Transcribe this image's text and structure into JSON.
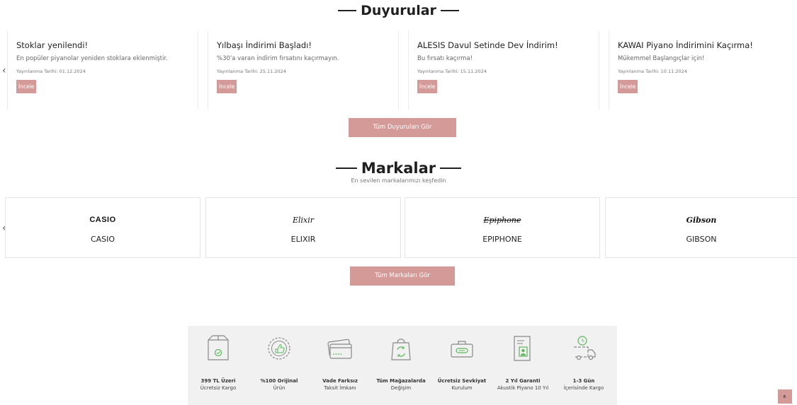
{
  "announcements": {
    "title": "Duyurular",
    "prev_arrow": "‹",
    "items": [
      {
        "title": "Stoklar yenilendi!",
        "desc": "En popüler piyanolar yeniden stoklara eklenmiştir.",
        "date": "Yayınlanma Tarihi: 01.12.2024",
        "button": "İncele"
      },
      {
        "title": "Yılbaşı İndirimi Başladı!",
        "desc": "%30'a varan indirim fırsatını kaçırmayın.",
        "date": "Yayınlanma Tarihi: 25.11.2024",
        "button": "İncele"
      },
      {
        "title": "ALESIS Davul Setinde Dev İndirim!",
        "desc": "Bu fırsatı kaçırma!",
        "date": "Yayınlanma Tarihi: 15.11.2024",
        "button": "İncele"
      },
      {
        "title": "KAWAI Piyano İndirimini Kaçırma!",
        "desc": "Mükemmel Başlangıçlar için!",
        "date": "Yayınlanma Tarihi: 10.11.2024",
        "button": "İncele"
      }
    ],
    "view_all": "Tüm Duyuruları Gör"
  },
  "brands": {
    "title": "Markalar",
    "subtitle": "En sevilen markalarımızı keşfedin",
    "prev_arrow": "‹",
    "items": [
      {
        "logo_text": "CASIO",
        "name": "CASIO"
      },
      {
        "logo_text": "Elixir",
        "name": "ELIXIR"
      },
      {
        "logo_text": "Epiphone",
        "name": "EPIPHONE"
      },
      {
        "logo_text": "Gibson",
        "name": "GIBSON"
      }
    ],
    "view_all": "Tüm Markaları Gör"
  },
  "features": [
    {
      "icon": "box-icon",
      "line1": "399 TL Üzeri",
      "line2": "Ücretsiz Kargo"
    },
    {
      "icon": "thumbs-up-badge-icon",
      "line1": "%100 Orijinal",
      "line2": "Ürün"
    },
    {
      "icon": "credit-card-icon",
      "line1": "Vade Farksız",
      "line2": "Taksit İmkanı"
    },
    {
      "icon": "exchange-bag-icon",
      "line1": "Tüm Mağazalarda",
      "line2": "Değişim"
    },
    {
      "icon": "toolbox-icon",
      "line1": "Ücretsiz Sevkiyat",
      "line2": "Kurulum"
    },
    {
      "icon": "warranty-certificate-icon",
      "line1": "2 Yıl Garanti",
      "line2": "Akustik Piyano 10 Yıl"
    },
    {
      "icon": "delivery-truck-icon",
      "line1": "1-3 Gün",
      "line2": "İçerisinde Kargo"
    }
  ],
  "scroll_top": "»",
  "colors": {
    "accent": "#d49a98",
    "icon_green": "#5cb85c",
    "feature_bg": "#f1f1f1"
  }
}
